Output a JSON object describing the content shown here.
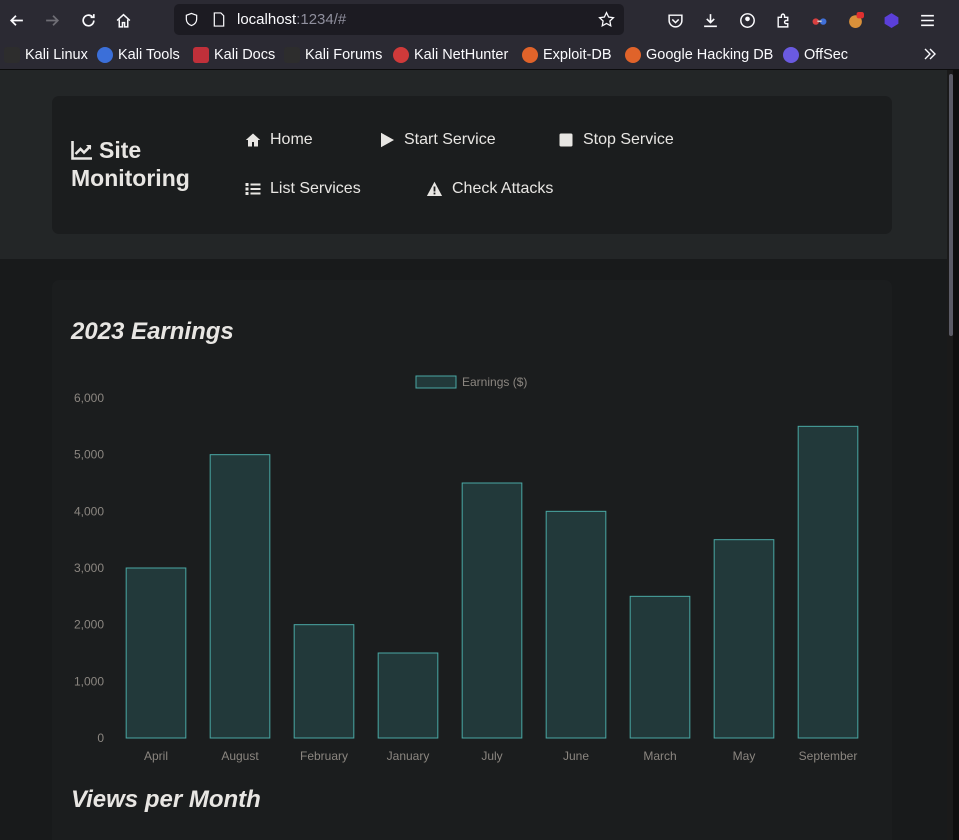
{
  "browser": {
    "url_host": "localhost",
    "url_path": ":1234/#",
    "bookmarks": [
      "Kali Linux",
      "Kali Tools",
      "Kali Docs",
      "Kali Forums",
      "Kali NetHunter",
      "Exploit-DB",
      "Google Hacking DB",
      "OffSec"
    ]
  },
  "nav": {
    "brand_line1": "Site",
    "brand_line2": "Monitoring",
    "links": [
      "Home",
      "Start Service",
      "Stop Service",
      "List Services",
      "Check Attacks"
    ]
  },
  "sections": {
    "earnings_title": "2023 Earnings",
    "views_title": "Views per Month"
  },
  "colors": {
    "bar_fill": "#22393a",
    "bar_stroke": "#4aa8a4",
    "axis_text": "#8b8680",
    "page_bg": "#181a1b"
  },
  "chart_data": {
    "type": "bar",
    "categories": [
      "April",
      "August",
      "February",
      "January",
      "July",
      "June",
      "March",
      "May",
      "September"
    ],
    "series": [
      {
        "name": "Earnings ($)",
        "values": [
          3000,
          5000,
          2000,
          1500,
          4500,
          4000,
          2500,
          3500,
          5500
        ]
      }
    ],
    "y_ticks": [
      "0",
      "1,000",
      "2,000",
      "3,000",
      "4,000",
      "5,000",
      "6,000"
    ],
    "ylim": [
      0,
      6000
    ],
    "legend": "top-center",
    "grid": false
  }
}
